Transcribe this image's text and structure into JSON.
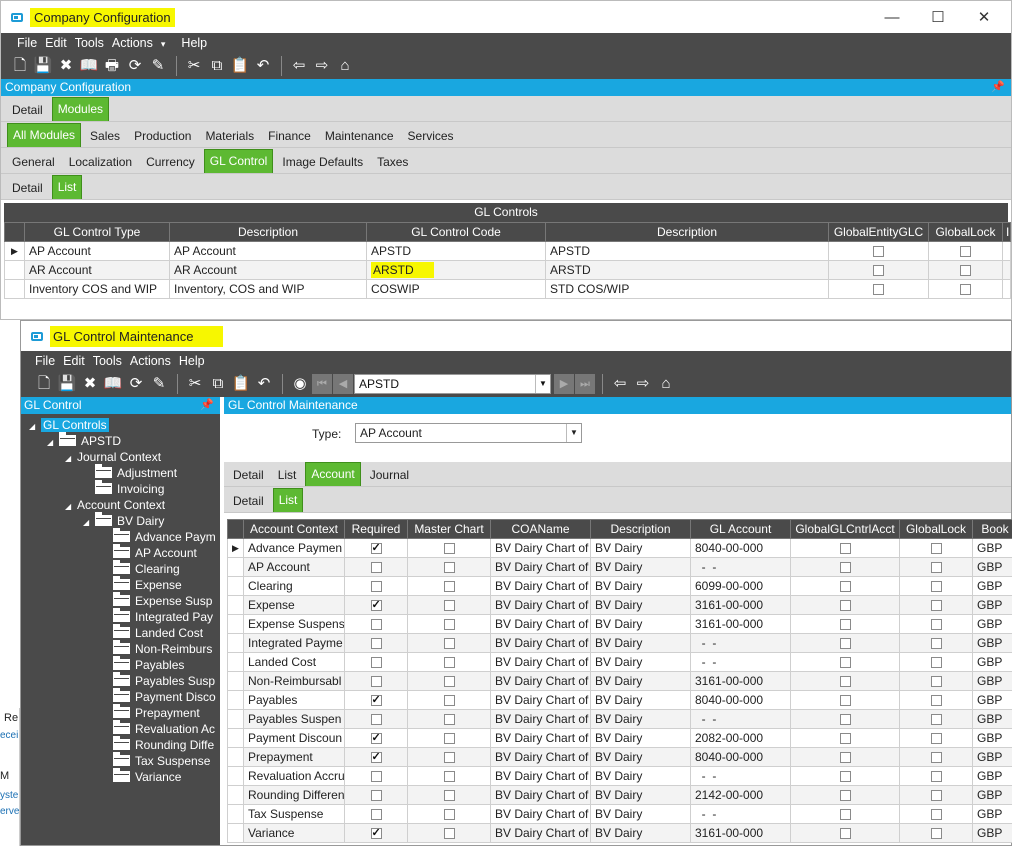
{
  "win1": {
    "title": "Company Configuration",
    "menu": [
      "File",
      "Edit",
      "Tools",
      "Actions",
      "Help"
    ],
    "actions_arrow": "▾",
    "panel_title": "Company Configuration",
    "tabs_l1": [
      "Detail",
      "Modules"
    ],
    "tabs_l2": [
      "All Modules",
      "Sales",
      "Production",
      "Materials",
      "Finance",
      "Maintenance",
      "Services"
    ],
    "tabs_l3": [
      "General",
      "Localization",
      "Currency",
      "GL Control",
      "Image Defaults",
      "Taxes"
    ],
    "tabs_l4": [
      "Detail",
      "List"
    ],
    "grid_caption": "GL Controls",
    "columns": [
      "GL Control Type",
      "Description",
      "GL Control Code",
      "Description",
      "GlobalEntityGLC",
      "GlobalLock",
      "I"
    ],
    "rows": [
      {
        "type": "AP Account",
        "desc": "AP Account",
        "code": "APSTD",
        "code_desc": "APSTD"
      },
      {
        "type": "AR Account",
        "desc": "AR Account",
        "code": "ARSTD",
        "code_desc": "ARSTD"
      },
      {
        "type": "Inventory COS and WIP",
        "desc": "Inventory, COS and WIP",
        "code": "COSWIP",
        "code_desc": "STD COS/WIP"
      }
    ]
  },
  "bg_fragments": [
    "Re",
    "ecei",
    "M",
    "yste",
    "erve"
  ],
  "win2": {
    "title": "GL Control Maintenance",
    "menu": [
      "File",
      "Edit",
      "Tools",
      "Actions",
      "Help"
    ],
    "nav_value": "APSTD",
    "left_title": "GL Control",
    "tree": [
      {
        "label": "GL Controls",
        "level": 0,
        "twisty": "◢",
        "folder": false,
        "selected": true
      },
      {
        "label": "APSTD",
        "level": 1,
        "twisty": "◢",
        "folder": true
      },
      {
        "label": "Journal Context",
        "level": 2,
        "twisty": "◢",
        "folder": false
      },
      {
        "label": "Adjustment",
        "level": 3,
        "twisty": "",
        "folder": true
      },
      {
        "label": "Invoicing",
        "level": 3,
        "twisty": "",
        "folder": true
      },
      {
        "label": "Account Context",
        "level": 2,
        "twisty": "◢",
        "folder": false
      },
      {
        "label": "BV Dairy",
        "level": 3,
        "twisty": "◢",
        "folder": true
      },
      {
        "label": "Advance Paym",
        "level": 4,
        "twisty": "",
        "folder": true
      },
      {
        "label": "AP Account",
        "level": 4,
        "twisty": "",
        "folder": true
      },
      {
        "label": "Clearing",
        "level": 4,
        "twisty": "",
        "folder": true
      },
      {
        "label": "Expense",
        "level": 4,
        "twisty": "",
        "folder": true
      },
      {
        "label": "Expense Susp",
        "level": 4,
        "twisty": "",
        "folder": true
      },
      {
        "label": "Integrated Pay",
        "level": 4,
        "twisty": "",
        "folder": true
      },
      {
        "label": "Landed Cost",
        "level": 4,
        "twisty": "",
        "folder": true
      },
      {
        "label": "Non-Reimburs",
        "level": 4,
        "twisty": "",
        "folder": true
      },
      {
        "label": "Payables",
        "level": 4,
        "twisty": "",
        "folder": true
      },
      {
        "label": "Payables Susp",
        "level": 4,
        "twisty": "",
        "folder": true
      },
      {
        "label": "Payment Disco",
        "level": 4,
        "twisty": "",
        "folder": true
      },
      {
        "label": "Prepayment",
        "level": 4,
        "twisty": "",
        "folder": true
      },
      {
        "label": "Revaluation Ac",
        "level": 4,
        "twisty": "",
        "folder": true
      },
      {
        "label": "Rounding Diffe",
        "level": 4,
        "twisty": "",
        "folder": true
      },
      {
        "label": "Tax Suspense",
        "level": 4,
        "twisty": "",
        "folder": true
      },
      {
        "label": "Variance",
        "level": 4,
        "twisty": "",
        "folder": true
      }
    ],
    "main_title": "GL Control Maintenance",
    "type_label": "Type:",
    "type_value": "AP Account",
    "tabs_a": [
      "Detail",
      "List",
      "Account",
      "Journal"
    ],
    "tabs_b": [
      "Detail",
      "List"
    ],
    "columns": [
      "Account Context",
      "Required",
      "Master Chart",
      "COAName",
      "Description",
      "GL Account",
      "GlobalGLCntrlAcct",
      "GlobalLock",
      "Book"
    ],
    "rows": [
      {
        "ctx": "Advance Paymen",
        "req": true,
        "coa": "BV Dairy Chart of",
        "desc": "BV Dairy",
        "acct": "8040-00-000",
        "book": "GBP"
      },
      {
        "ctx": "AP Account",
        "req": false,
        "coa": "BV Dairy Chart of",
        "desc": "BV Dairy",
        "acct": "  -  -",
        "book": "GBP"
      },
      {
        "ctx": "Clearing",
        "req": false,
        "coa": "BV Dairy Chart of",
        "desc": "BV Dairy",
        "acct": "6099-00-000",
        "book": "GBP"
      },
      {
        "ctx": "Expense",
        "req": true,
        "coa": "BV Dairy Chart of",
        "desc": "BV Dairy",
        "acct": "3161-00-000",
        "book": "GBP"
      },
      {
        "ctx": "Expense Suspens",
        "req": false,
        "coa": "BV Dairy Chart of",
        "desc": "BV Dairy",
        "acct": "3161-00-000",
        "book": "GBP"
      },
      {
        "ctx": "Integrated Payme",
        "req": false,
        "coa": "BV Dairy Chart of",
        "desc": "BV Dairy",
        "acct": "  -  -",
        "book": "GBP"
      },
      {
        "ctx": "Landed Cost",
        "req": false,
        "coa": "BV Dairy Chart of",
        "desc": "BV Dairy",
        "acct": "  -  -",
        "book": "GBP"
      },
      {
        "ctx": "Non-Reimbursabl",
        "req": false,
        "coa": "BV Dairy Chart of",
        "desc": "BV Dairy",
        "acct": "3161-00-000",
        "book": "GBP"
      },
      {
        "ctx": "Payables",
        "req": true,
        "coa": "BV Dairy Chart of",
        "desc": "BV Dairy",
        "acct": "8040-00-000",
        "book": "GBP"
      },
      {
        "ctx": "Payables Suspen",
        "req": false,
        "coa": "BV Dairy Chart of",
        "desc": "BV Dairy",
        "acct": "  -  -",
        "book": "GBP"
      },
      {
        "ctx": "Payment Discoun",
        "req": true,
        "coa": "BV Dairy Chart of",
        "desc": "BV Dairy",
        "acct": "2082-00-000",
        "book": "GBP"
      },
      {
        "ctx": "Prepayment",
        "req": true,
        "coa": "BV Dairy Chart of",
        "desc": "BV Dairy",
        "acct": "8040-00-000",
        "book": "GBP"
      },
      {
        "ctx": "Revaluation Accru",
        "req": false,
        "coa": "BV Dairy Chart of",
        "desc": "BV Dairy",
        "acct": "  -  -",
        "book": "GBP"
      },
      {
        "ctx": "Rounding Differen",
        "req": false,
        "coa": "BV Dairy Chart of",
        "desc": "BV Dairy",
        "acct": "2142-00-000",
        "book": "GBP"
      },
      {
        "ctx": "Tax Suspense",
        "req": false,
        "coa": "BV Dairy Chart of",
        "desc": "BV Dairy",
        "acct": "  -  -",
        "book": "GBP"
      },
      {
        "ctx": "Variance",
        "req": true,
        "coa": "BV Dairy Chart of",
        "desc": "BV Dairy",
        "acct": "3161-00-000",
        "book": "GBP"
      }
    ]
  },
  "colors": {
    "accent_green": "#5db932",
    "panel_blue": "#19a7e0",
    "dark_bar": "#4a4a4a",
    "highlight": "#f7f700"
  }
}
